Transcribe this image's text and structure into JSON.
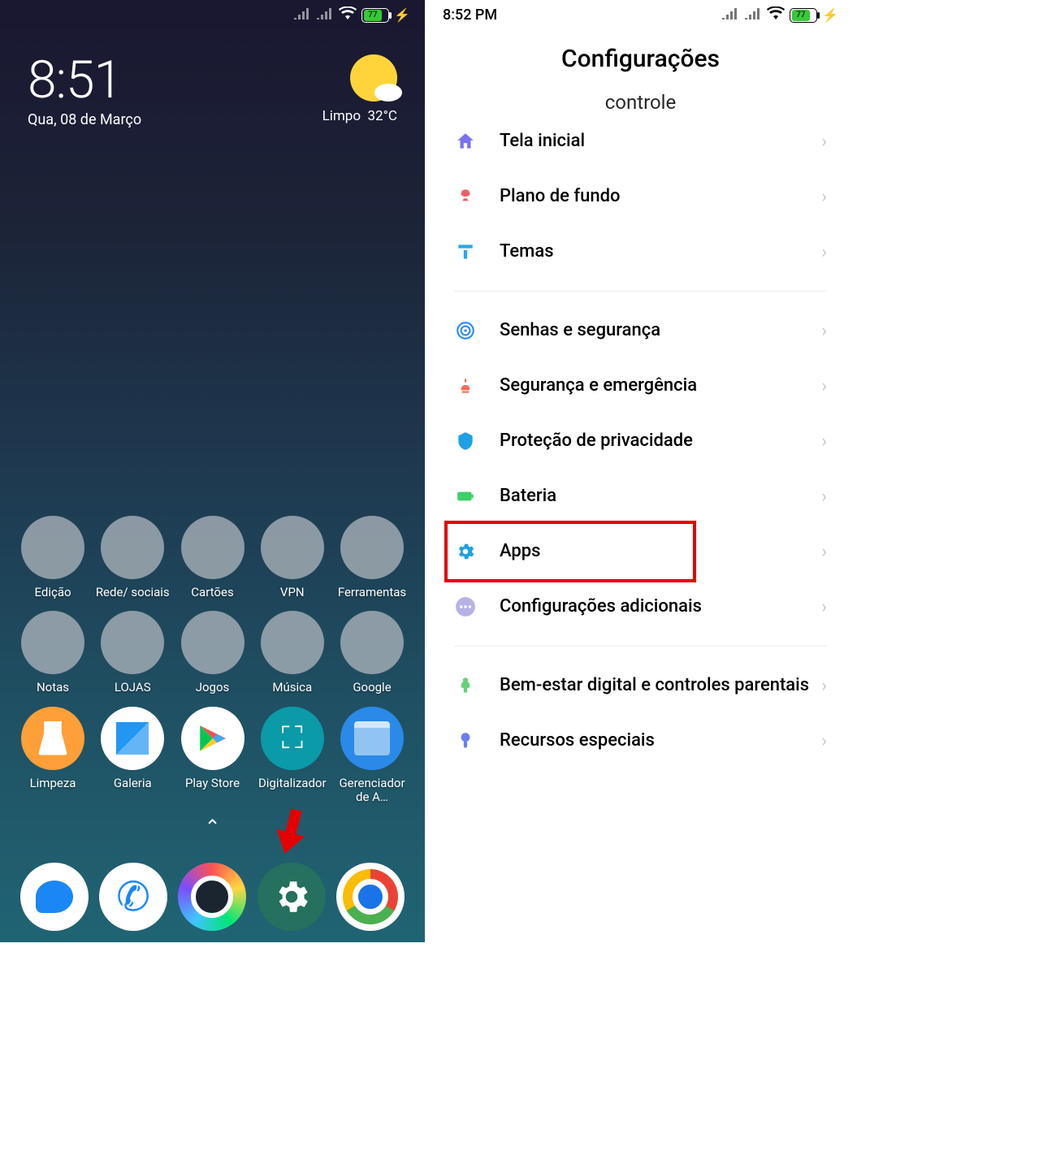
{
  "left": {
    "battery_level": "77",
    "time": "8:51",
    "date": "Qua, 08 de Março",
    "weather_cond": "Limpo",
    "weather_temp": "32°C",
    "folders_row1": [
      {
        "label": "Edição"
      },
      {
        "label": "Rede/ sociais"
      },
      {
        "label": "Cartões"
      },
      {
        "label": "VPN"
      },
      {
        "label": "Ferramentas"
      }
    ],
    "folders_row2": [
      {
        "label": "Notas"
      },
      {
        "label": "LOJAS"
      },
      {
        "label": "Jogos"
      },
      {
        "label": "Música"
      },
      {
        "label": "Google"
      }
    ],
    "apps_row3": [
      {
        "label": "Limpeza",
        "name": "app-limpeza"
      },
      {
        "label": "Galeria",
        "name": "app-galeria"
      },
      {
        "label": "Play Store",
        "name": "app-playstore"
      },
      {
        "label": "Digitalizador",
        "name": "app-digitalizador"
      },
      {
        "label": "Gerenciador de A…",
        "name": "app-gerenciador"
      }
    ],
    "indicator_glyph": "⌃",
    "dock": [
      {
        "name": "dock-messages"
      },
      {
        "name": "dock-phone"
      },
      {
        "name": "dock-camera"
      },
      {
        "name": "dock-settings"
      },
      {
        "name": "dock-chrome"
      }
    ]
  },
  "right": {
    "time": "8:52 PM",
    "battery_level": "77",
    "title": "Configurações",
    "cutoff_text": "controle",
    "group1": [
      {
        "label": "Tela inicial",
        "icon": "home-icon",
        "color": "#7a72f1"
      },
      {
        "label": "Plano de fundo",
        "icon": "wallpaper-icon",
        "color": "#f05e6b"
      },
      {
        "label": "Temas",
        "icon": "themes-icon",
        "color": "#29a7ee"
      }
    ],
    "group2": [
      {
        "label": "Senhas e segurança",
        "icon": "fingerprint-icon",
        "color": "#2e8df5"
      },
      {
        "label": "Segurança e emergência",
        "icon": "emergency-icon",
        "color": "#f46a56"
      },
      {
        "label": "Proteção de privacidade",
        "icon": "privacy-icon",
        "color": "#1ea0e6"
      },
      {
        "label": "Bateria",
        "icon": "battery-icon",
        "color": "#3bd169"
      },
      {
        "label": "Apps",
        "icon": "apps-icon",
        "color": "#1ea0e6",
        "highlight": true
      },
      {
        "label": "Configurações adicionais",
        "icon": "more-icon",
        "color": "#b5b2e8"
      }
    ],
    "group3": [
      {
        "label": "Bem-estar digital e controles parentais",
        "icon": "wellbeing-icon",
        "color": "#69d07d"
      },
      {
        "label": "Recursos especiais",
        "icon": "special-icon",
        "color": "#6a7ef0"
      }
    ]
  }
}
